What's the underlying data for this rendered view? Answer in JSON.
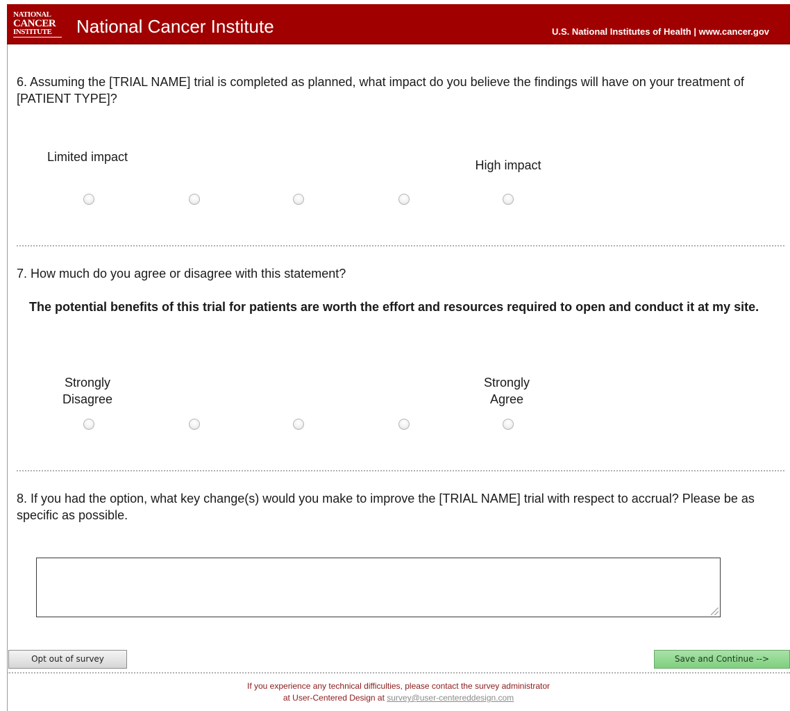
{
  "header": {
    "logo_line1": "NATIONAL",
    "logo_line2": "CANCER",
    "logo_line3": "INSTITUTE",
    "org_name": "National Cancer Institute",
    "nih_links": "U.S. National Institutes of Health  |  www.cancer.gov"
  },
  "q6": {
    "text": "6. Assuming the [TRIAL NAME] trial is completed as planned, what impact do you believe the findings will have on your treatment of [PATIENT TYPE]?",
    "low_label": "Limited impact",
    "high_label": "High impact",
    "selected": null
  },
  "q7": {
    "text": "7. How much do you agree or disagree with this statement?",
    "statement": "The potential benefits of this trial for patients are worth the effort and resources required to open and conduct it at my site.",
    "low_label": "Strongly Disagree",
    "high_label": "Strongly Agree",
    "selected": null
  },
  "q8": {
    "text": "8. If you had the option, what key change(s) would you make to improve the [TRIAL NAME] trial with respect to accrual? Please be as specific as possible.",
    "answer": ""
  },
  "buttons": {
    "opt_out": "Opt out of survey",
    "save_continue": "Save and Continue -->"
  },
  "footer": {
    "line1": "If you experience any technical difficulties, please contact the survey administrator",
    "line2_prefix": "at User-Centered Design at ",
    "email": "survey@user-centereddesign.com"
  },
  "colors": {
    "header_bg": "#a00000",
    "save_button": "#8fd68f",
    "footer_text": "#8b1a1a"
  }
}
